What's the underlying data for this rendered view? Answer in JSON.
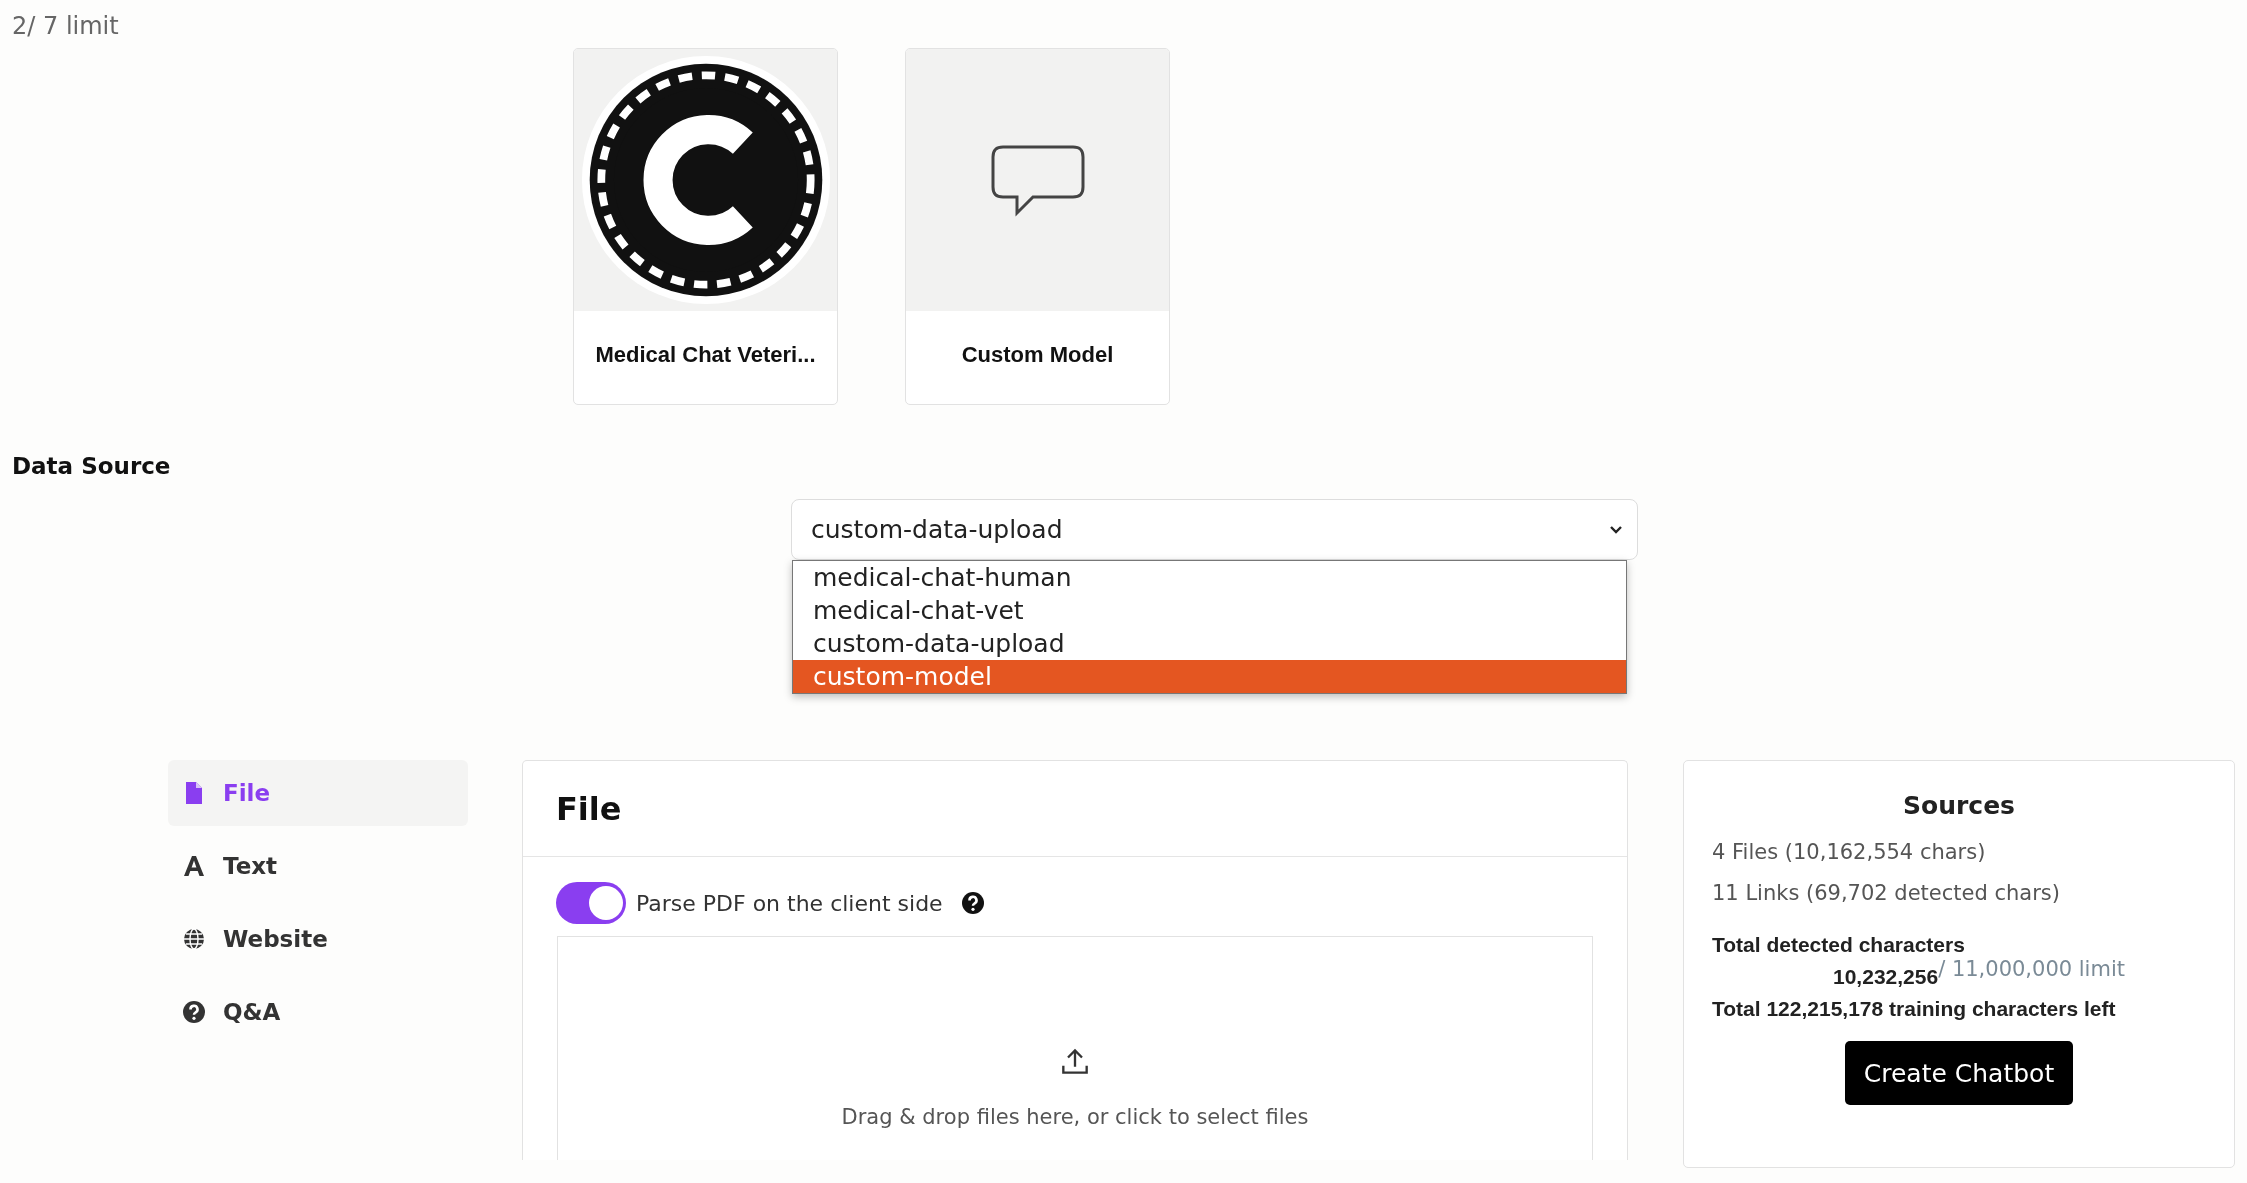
{
  "usage": "2/ 7 limit",
  "models": [
    {
      "name": "Medical Chat Veteri...",
      "kind": "copyright"
    },
    {
      "name": "Custom Model",
      "kind": "chat"
    }
  ],
  "data_source": {
    "heading": "Data Source",
    "value": "custom-data-upload",
    "options": [
      {
        "label": "medical-chat-human",
        "highlighted": false
      },
      {
        "label": "medical-chat-vet",
        "highlighted": false
      },
      {
        "label": "custom-data-upload",
        "highlighted": false
      },
      {
        "label": "custom-model",
        "highlighted": true
      }
    ]
  },
  "sidebar": {
    "items": [
      {
        "label": "File",
        "kind": "file",
        "selected": true
      },
      {
        "label": "Text",
        "kind": "text",
        "selected": false
      },
      {
        "label": "Website",
        "kind": "globe",
        "selected": false
      },
      {
        "label": "Q&A",
        "kind": "question",
        "selected": false
      }
    ]
  },
  "file_panel": {
    "title": "File",
    "toggle": {
      "label": "Parse PDF on the client side",
      "on": true
    },
    "dropzone": "Drag & drop files here, or click to select files"
  },
  "sources": {
    "title": "Sources",
    "files": "4 Files (10,162,554 chars)",
    "links": "11 Links (69,702 detected chars)",
    "total_label": "Total detected characters",
    "total_value": "10,232,256",
    "limit": "/ 11,000,000 limit",
    "left": "Total 122,215,178 training characters left",
    "button": "Create Chatbot"
  }
}
